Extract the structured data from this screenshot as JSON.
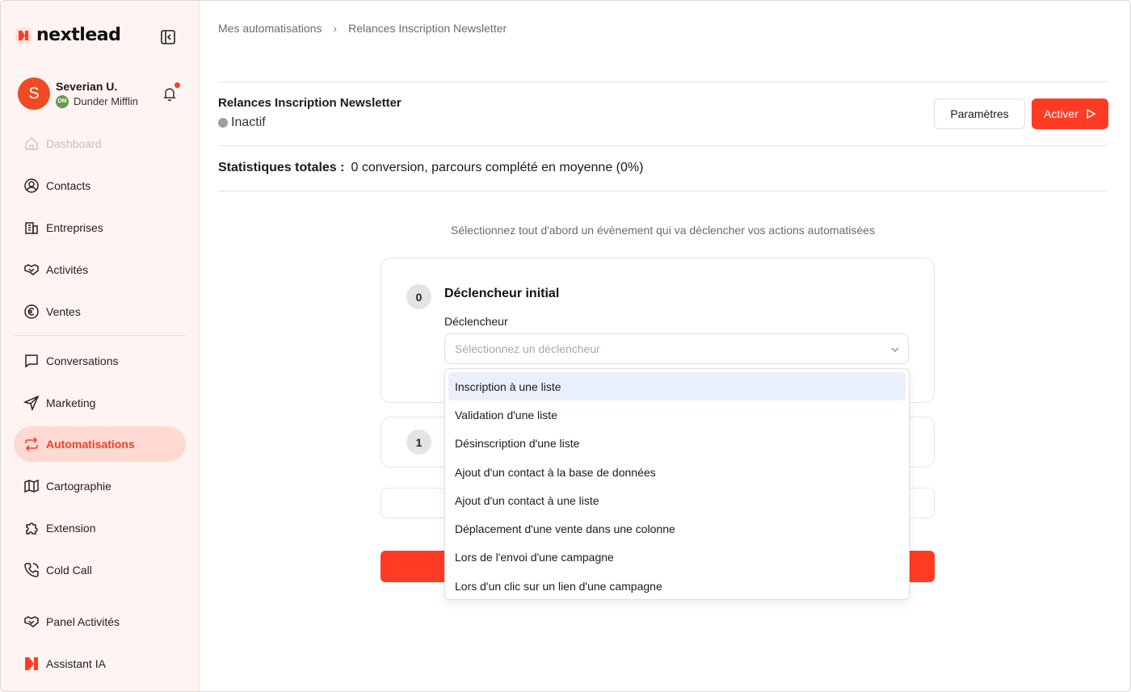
{
  "app": {
    "logo_text": "nextlead",
    "brand_color": "#ff3b24"
  },
  "user": {
    "initial": "S",
    "name": "Severian U.",
    "org_initials": "DM",
    "org_name": "Dunder Mifflin"
  },
  "sidebar": {
    "items": [
      {
        "label": "Dashboard",
        "icon": "home-icon"
      },
      {
        "label": "Contacts",
        "icon": "user-circle-icon"
      },
      {
        "label": "Entreprises",
        "icon": "building-icon"
      },
      {
        "label": "Activités",
        "icon": "handshake-icon"
      },
      {
        "label": "Ventes",
        "icon": "euro-icon"
      },
      {
        "label": "Conversations",
        "icon": "chat-icon"
      },
      {
        "label": "Marketing",
        "icon": "send-icon"
      },
      {
        "label": "Automatisations",
        "icon": "repeat-icon"
      },
      {
        "label": "Cartographie",
        "icon": "map-icon"
      },
      {
        "label": "Extension",
        "icon": "puzzle-icon"
      },
      {
        "label": "Cold Call",
        "icon": "phone-icon"
      },
      {
        "label": "Panel Activités",
        "icon": "handshake-icon"
      },
      {
        "label": "Assistant IA",
        "icon": "nextlead-logo-icon"
      }
    ]
  },
  "breadcrumb": {
    "parent": "Mes automatisations",
    "current": "Relances Inscription Newsletter"
  },
  "automation": {
    "title": "Relances Inscription Newsletter",
    "status": "Inactif",
    "params_label": "Paramètres",
    "activate_label": "Activer"
  },
  "stats": {
    "label": "Statistiques totales :",
    "value": "0 conversion, parcours complété en moyenne (0%)"
  },
  "hint": "Sélectionnez tout d'abord un évènement qui va déclencher vos actions automatisées",
  "trigger_card": {
    "step": "0",
    "title": "Déclencheur initial",
    "field_label": "Déclencheur",
    "placeholder": "Sélectionnez un déclencheur"
  },
  "step_card": {
    "step": "1"
  },
  "dropdown": {
    "options": [
      "Inscription à une liste",
      "Validation d'une liste",
      "Désinscription d'une liste",
      "Ajout d'un contact à la base de données",
      "Ajout d'un contact à une liste",
      "Déplacement d'une vente dans une colonne",
      "Lors de l'envoi d'une campagne",
      "Lors d'un clic sur un lien d'une campagne"
    ],
    "highlighted_index": 0
  }
}
